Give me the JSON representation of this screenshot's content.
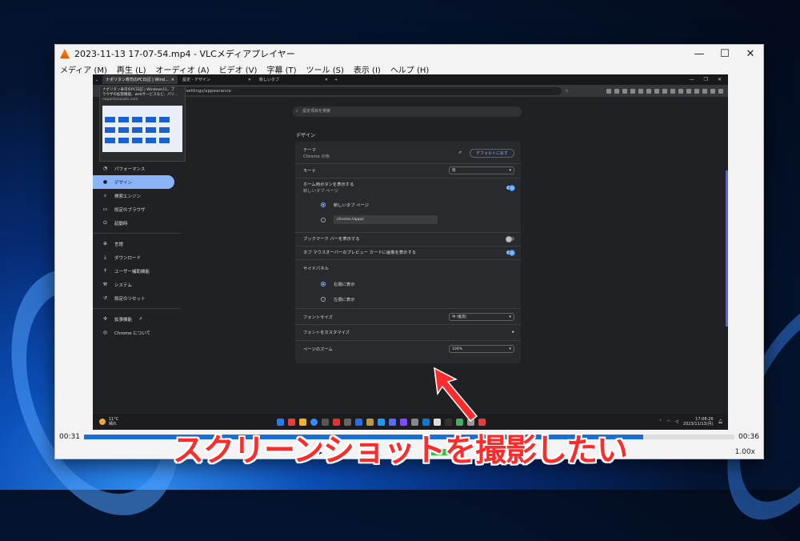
{
  "vlc": {
    "title": "2023-11-13 17-07-54.mp4 - VLCメディアプレイヤー",
    "menu": [
      "メディア (M)",
      "再生 (L)",
      "オーディオ (A)",
      "ビデオ (V)",
      "字幕 (T)",
      "ツール (S)",
      "表示 (I)",
      "ヘルプ (H)"
    ],
    "elapsed": "00:31",
    "duration": "00:36",
    "progress": 0.86,
    "rate": "1.00x"
  },
  "browser": {
    "tabs": [
      {
        "label": "ナポリタン寿司のPC日記 | Wind...",
        "active": true
      },
      {
        "label": "設定 - デザイン",
        "active": false
      },
      {
        "label": "新しいタブ",
        "active": false
      }
    ],
    "address": "chrome://settings/appearance",
    "tooltip": {
      "line1": "ナポリタン寿司のPC日記 | Windows11、ブ",
      "line2": "ラウザの拡張機能、webサービスなど、パソ...",
      "domain": "naporitansushi.com"
    }
  },
  "sidebar": {
    "items": [
      {
        "label": "パフォーマンス",
        "icon": "speedometer-icon",
        "active": false
      },
      {
        "label": "デザイン",
        "icon": "palette-icon",
        "active": true
      },
      {
        "label": "検索エンジン",
        "icon": "search-icon",
        "active": false
      },
      {
        "label": "既定のブラウザ",
        "icon": "browser-icon",
        "active": false
      },
      {
        "label": "起動時",
        "icon": "power-icon",
        "active": false
      },
      {
        "label": "言語",
        "icon": "globe-icon",
        "active": false
      },
      {
        "label": "ダウンロード",
        "icon": "download-icon",
        "active": false
      },
      {
        "label": "ユーザー補助機能",
        "icon": "accessibility-icon",
        "active": false
      },
      {
        "label": "システム",
        "icon": "wrench-icon",
        "active": false
      },
      {
        "label": "設定のリセット",
        "icon": "reset-icon",
        "active": false
      },
      {
        "label": "拡張機能",
        "icon": "puzzle-icon",
        "active": false
      },
      {
        "label": "Chrome について",
        "icon": "chrome-icon",
        "active": false
      }
    ]
  },
  "settings": {
    "search_placeholder": "設定項目を検索",
    "section_title": "デザイン",
    "theme_label": "テーマ",
    "theme_sub": "Chrome の色",
    "reset_button": "デフォルトに戻す",
    "mode_label": "モード",
    "mode_value": "暗",
    "home_label": "ホーム用ボタンを表示する",
    "home_sub": "新しいタブ ページ",
    "home_opt1": "新しいタブ ページ",
    "home_opt2_value": "chrome://apps/",
    "bookmarks_label": "ブックマーク バーを表示する",
    "tab_preview_label": "タブ マウスオーバーのプレビュー カードに画像を表示する",
    "side_panel_label": "サイドパネル",
    "side_right": "右側に表示",
    "side_left": "左側に表示",
    "font_size_label": "フォントサイズ",
    "font_size_value": "中 (推奨)",
    "customize_fonts_label": "フォントをカスタマイズ",
    "zoom_label": "ページのズーム",
    "zoom_value": "100%"
  },
  "taskbar": {
    "temp": "11°C",
    "weather": "晴れ",
    "time": "17:08:26",
    "date": "2023/11/13(月)"
  },
  "colors": {
    "accent": "#8ab4f8",
    "caption": "#ff2b2b",
    "seek": "#1a6fd6"
  },
  "caption": "スクリーンショットを撮影したい"
}
